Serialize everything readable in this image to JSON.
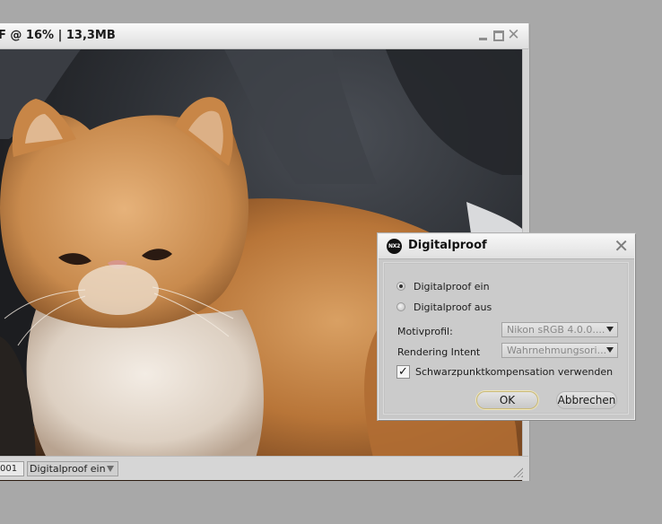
{
  "document_window": {
    "title": "F @ 16% | 13,3MB",
    "status": {
      "zoom_text": "001",
      "proof_select_value": "Digitalproof ein"
    }
  },
  "dialog": {
    "title": "Digitalproof",
    "logo_text": "NX2",
    "radio_on_label": "Digitalproof ein",
    "radio_off_label": "Digitalproof aus",
    "radio_selected": "on",
    "motivprofil_label": "Motivprofil:",
    "motivprofil_value": "Nikon sRGB 4.0.0....",
    "rendering_label": "Rendering Intent",
    "rendering_value": "Wahrnehmungsori...",
    "bpc_label": "Schwarzpunktkompensation verwenden",
    "bpc_checked": true,
    "ok_label": "OK",
    "cancel_label": "Abbrechen"
  },
  "colors": {
    "desktop": "#a8a8a8",
    "cat_fur": "#c98a4e",
    "background_fabric": "#2e3136"
  }
}
